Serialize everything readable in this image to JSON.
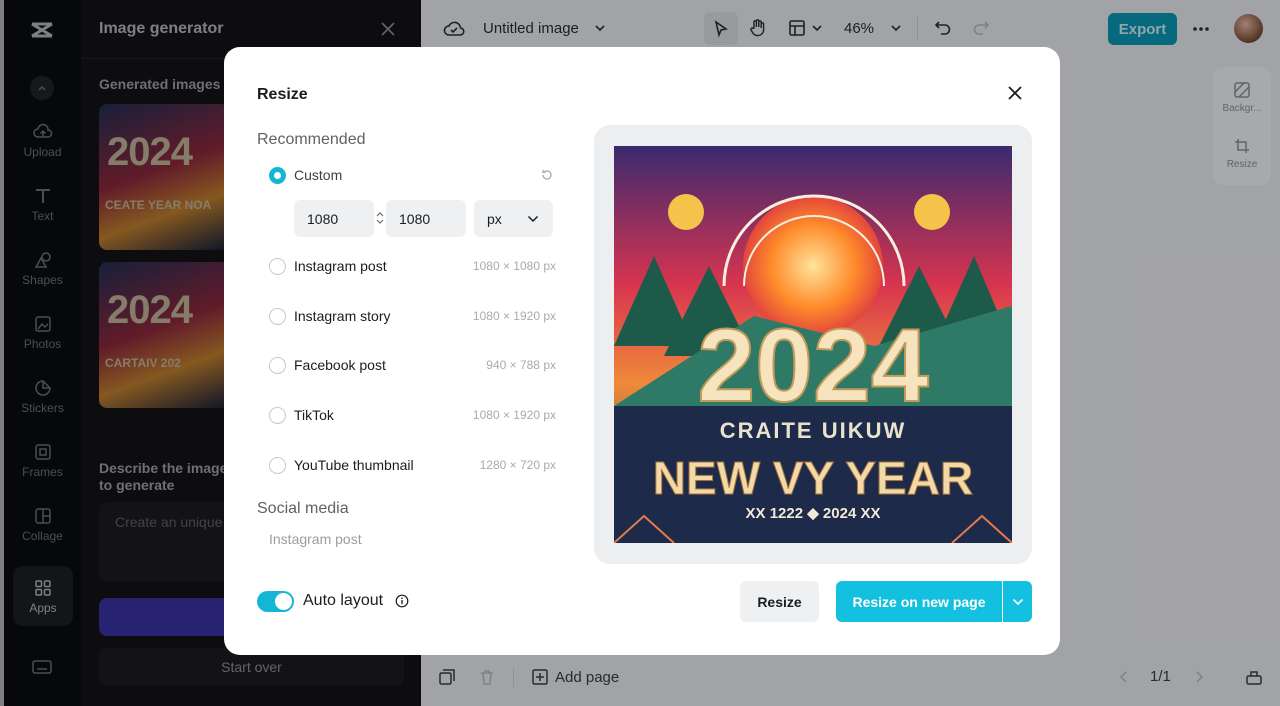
{
  "rail": {
    "items": [
      {
        "label": "Upload",
        "icon": "upload-cloud-icon"
      },
      {
        "label": "Text",
        "icon": "text-icon"
      },
      {
        "label": "Shapes",
        "icon": "shapes-icon"
      },
      {
        "label": "Photos",
        "icon": "photos-icon"
      },
      {
        "label": "Stickers",
        "icon": "stickers-icon"
      },
      {
        "label": "Frames",
        "icon": "frames-icon"
      },
      {
        "label": "Collage",
        "icon": "collage-icon"
      },
      {
        "label": "Apps",
        "icon": "apps-grid-icon"
      }
    ]
  },
  "panel": {
    "title": "Image generator",
    "generated_label": "Generated images",
    "thumb1": {
      "big": "2024",
      "sub": "CEATE YEAR NOA"
    },
    "thumb2": {
      "big": "2024",
      "sub": "CARTAIV 202"
    },
    "describe_label": "Describe the image to generate",
    "prompt_placeholder": "Create an unique",
    "start_over": "Start over"
  },
  "topbar": {
    "doc_title": "Untitled image",
    "zoom": "46%",
    "export": "Export"
  },
  "tools": [
    {
      "label": "Backgr...",
      "icon": "background-icon"
    },
    {
      "label": "Resize",
      "icon": "resize-icon"
    }
  ],
  "bottombar": {
    "add_page": "Add page",
    "page_indicator": "1/1"
  },
  "modal": {
    "title": "Resize",
    "recommended": "Recommended",
    "custom": {
      "label": "Custom",
      "width": "1080",
      "height": "1080",
      "unit": "px"
    },
    "options": [
      {
        "label": "Instagram post",
        "dims": "1080 × 1080 px"
      },
      {
        "label": "Instagram story",
        "dims": "1080 × 1920 px"
      },
      {
        "label": "Facebook post",
        "dims": "940 × 788 px"
      },
      {
        "label": "TikTok",
        "dims": "1080 × 1920 px"
      },
      {
        "label": "YouTube thumbnail",
        "dims": "1280 × 720 px"
      }
    ],
    "social_media": "Social media",
    "social_first": "Instagram post",
    "preview": {
      "year": "2024",
      "line1": "CRAITE UIKUW",
      "line2": "NEW VY YEAR",
      "line3": "XX 1222 ◆ 2024 XX"
    },
    "auto_layout": "Auto layout",
    "resize_btn": "Resize",
    "resize_new_page_btn": "Resize on new page",
    "accent": "#14c0e0"
  }
}
